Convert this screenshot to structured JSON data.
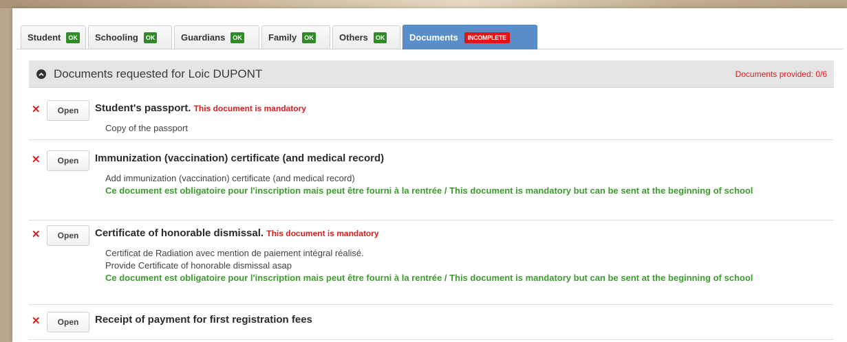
{
  "tabs": [
    {
      "label": "Student",
      "status": "OK"
    },
    {
      "label": "Schooling",
      "status": "OK"
    },
    {
      "label": "Guardians",
      "status": "OK"
    },
    {
      "label": "Family",
      "status": "OK"
    },
    {
      "label": "Others",
      "status": "OK"
    },
    {
      "label": "Documents",
      "status": "INCOMPLETE"
    }
  ],
  "header": {
    "title": "Documents requested for Loic DUPONT",
    "status": "Documents provided: 0/6"
  },
  "open_label": "Open",
  "documents": [
    {
      "title": "Student's passport",
      "mandatory_text": "This document is mandatory",
      "lines": [
        "Copy of the passport"
      ],
      "note": ""
    },
    {
      "title": "Immunization (vaccination) certificate (and medical record)",
      "mandatory_text": "",
      "lines": [
        "Add immunization (vaccination) certificate (and medical record)"
      ],
      "note": "Ce document est obligatoire pour l'inscription mais peut être fourni à la rentrée / This document is mandatory but can be sent at the beginning of school"
    },
    {
      "title": "Certificate of honorable dismissal",
      "mandatory_text": "This document is mandatory",
      "lines": [
        "Certificat de Radiation avec mention de paiement intégral réalisé.",
        "Provide Certificate of honorable dismissal asap"
      ],
      "note": "Ce document est obligatoire pour l'inscription mais peut être fourni à la rentrée / This document is mandatory but can be sent at the beginning of school"
    },
    {
      "title": "Receipt of payment for first registration fees",
      "mandatory_text": "",
      "lines": [],
      "note": ""
    }
  ],
  "colors": {
    "tab_active": "#5a8ecb",
    "badge_ok": "#2f8a27",
    "badge_incomplete": "#e01616",
    "mandatory_red": "#d82020",
    "note_green": "#3d9b2f"
  },
  "icons": {
    "collapse": "chevron-up-circle-icon",
    "missing": "cross-icon"
  }
}
